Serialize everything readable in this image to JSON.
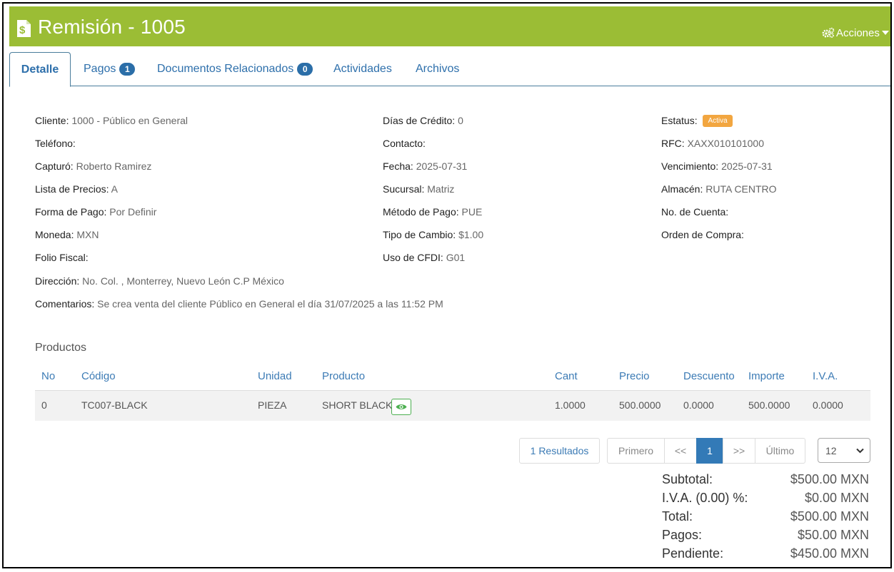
{
  "header": {
    "title": "Remisión - 1005",
    "actions_label": "Acciones",
    "bg_color": "#9bbd35"
  },
  "tabs": [
    {
      "label": "Detalle",
      "active": true
    },
    {
      "label": "Pagos",
      "badge": "1"
    },
    {
      "label": "Documentos Relacionados",
      "badge": "0"
    },
    {
      "label": "Actividades"
    },
    {
      "label": "Archivos"
    }
  ],
  "details": {
    "col1": [
      {
        "label": "Cliente:",
        "value": "1000 - Público en General"
      },
      {
        "label": "Teléfono:",
        "value": ""
      },
      {
        "label": "Capturó:",
        "value": "Roberto Ramirez"
      },
      {
        "label": "Lista de Precios:",
        "value": "A"
      },
      {
        "label": "Forma de Pago:",
        "value": "Por Definir"
      },
      {
        "label": "Moneda:",
        "value": "MXN"
      },
      {
        "label": "Folio Fiscal:",
        "value": ""
      },
      {
        "label": "Dirección:",
        "value": "No. Col. , Monterrey, Nuevo León C.P México"
      },
      {
        "label": "Comentarios:",
        "value": "Se crea venta del cliente Público en General el día 31/07/2025 a las 11:52 PM"
      }
    ],
    "col2": [
      {
        "label": "Días de Crédito:",
        "value": "0"
      },
      {
        "label": "Contacto:",
        "value": ""
      },
      {
        "label": "Fecha:",
        "value": "2025-07-31"
      },
      {
        "label": "Sucursal:",
        "value": "Matriz"
      },
      {
        "label": "Método de Pago:",
        "value": "PUE"
      },
      {
        "label": "Tipo de Cambio:",
        "value": "$1.00"
      },
      {
        "label": "Uso de CFDI:",
        "value": "G01"
      }
    ],
    "col3": [
      {
        "label": "Estatus:",
        "value": "Activa"
      },
      {
        "label": "RFC:",
        "value": "XAXX010101000"
      },
      {
        "label": "Vencimiento:",
        "value": "2025-07-31"
      },
      {
        "label": "Almacén:",
        "value": "RUTA CENTRO"
      },
      {
        "label": "No. de Cuenta:",
        "value": ""
      },
      {
        "label": "Orden de Compra:",
        "value": ""
      }
    ],
    "status_color": "#f2a640"
  },
  "products": {
    "title": "Productos",
    "columns": [
      "No",
      "Código",
      "Unidad",
      "Producto",
      "Cant",
      "Precio",
      "Descuento",
      "Importe",
      "I.V.A."
    ],
    "rows": [
      [
        "0",
        "TC007-BLACK",
        "PIEZA",
        "SHORT BLACK",
        "1.0000",
        "500.0000",
        "0.0000",
        "500.0000",
        "0.0000"
      ]
    ]
  },
  "pagination": {
    "results": "1 Resultados",
    "first": "Primero",
    "prev": "<<",
    "current": "1",
    "next": ">>",
    "last": "Último",
    "page_size": "12"
  },
  "totals": [
    {
      "label": "Subtotal:",
      "value": "$500.00 MXN"
    },
    {
      "label": "I.V.A. (0.00) %:",
      "value": "$0.00 MXN"
    },
    {
      "label": "Total:",
      "value": "$500.00 MXN"
    },
    {
      "label": "Pagos:",
      "value": "$50.00 MXN"
    },
    {
      "label": "Pendiente:",
      "value": "$450.00 MXN"
    }
  ]
}
